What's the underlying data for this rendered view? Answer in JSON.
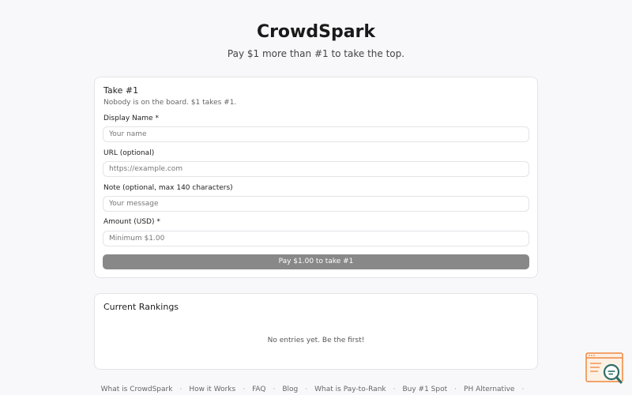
{
  "header": {
    "title": "CrowdSpark",
    "subtitle": "Pay $1 more than #1 to take the top."
  },
  "form": {
    "title": "Take #1",
    "description": "Nobody is on the board. $1 takes #1.",
    "fields": [
      {
        "label": "Display Name *",
        "placeholder": "Your name",
        "value": ""
      },
      {
        "label": "URL (optional)",
        "placeholder": "https://example.com",
        "value": ""
      },
      {
        "label": "Note (optional, max 140 characters)",
        "placeholder": "Your message",
        "value": ""
      },
      {
        "label": "Amount (USD) *",
        "placeholder": "Minimum $1.00",
        "value": ""
      }
    ],
    "submit_label": "Pay $1.00 to take #1"
  },
  "rankings": {
    "title": "Current Rankings",
    "empty_message": "No entries yet. Be the first!"
  },
  "footer": {
    "links": [
      "What is CrowdSpark",
      "How it Works",
      "FAQ",
      "Blog",
      "What is Pay-to-Rank",
      "Buy #1 Spot",
      "PH Alternative"
    ],
    "separator": "·"
  },
  "colors": {
    "widget_accent": "#f0883e",
    "widget_magnifier": "#2f6e66"
  },
  "icons": {
    "widget": "search-widget-icon"
  }
}
